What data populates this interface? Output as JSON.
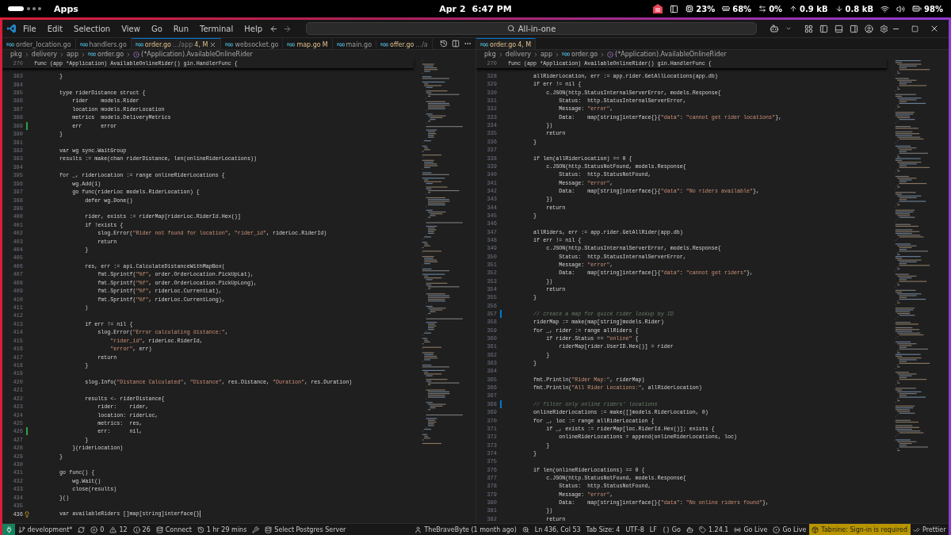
{
  "system_bar": {
    "apps": "Apps",
    "date": "Apr 2",
    "time": "6:47 PM",
    "indicators": [
      {
        "kind": "cpu",
        "text": "23%"
      },
      {
        "kind": "memory",
        "text": "68%"
      },
      {
        "kind": "swap",
        "text": "0%"
      },
      {
        "kind": "upload",
        "text": "0.9 kB"
      },
      {
        "kind": "download",
        "text": "0.8 kB"
      }
    ],
    "battery": "98%"
  },
  "menu": [
    "File",
    "Edit",
    "Selection",
    "View",
    "Go",
    "Run",
    "Terminal",
    "Help"
  ],
  "command_center": {
    "label": "All-in-one"
  },
  "editors": [
    {
      "tabs": [
        {
          "label": "order_location.go",
          "selected": false,
          "modified": false
        },
        {
          "label": "handlers.go",
          "selected": false,
          "modified": false
        },
        {
          "label": "order.go",
          "detail": ".../app",
          "status": "4, M",
          "selected": true,
          "modified": true
        },
        {
          "label": "websocket.go",
          "selected": false,
          "modified": false
        },
        {
          "label": "map.go",
          "status": "M",
          "selected": false,
          "modified": true
        },
        {
          "label": "main.go",
          "selected": false,
          "modified": false
        },
        {
          "label": "offer.go",
          "detail": ".../a",
          "selected": false,
          "modified": true
        }
      ],
      "breadcrumbs": [
        "pkg",
        "delivery",
        "app",
        "order.go",
        "(*Application).AvailableOnlineRider"
      ],
      "sticky": {
        "n": "270",
        "text": "func (app *Application) AvailableOnlineRider() gin.HandlerFunc {"
      },
      "lines": [
        {
          "n": "383",
          "text": "        }"
        },
        {
          "n": "384"
        },
        {
          "n": "385",
          "text": "        type riderDistance struct {"
        },
        {
          "n": "386",
          "text": "            rider    models.Rider"
        },
        {
          "n": "387",
          "text": "            location models.RiderLocation"
        },
        {
          "n": "388",
          "text": "            metrics  models.DeliveryMetrics"
        },
        {
          "n": "389",
          "text": "            err      error",
          "kind": "added"
        },
        {
          "n": "390",
          "text": "        }"
        },
        {
          "n": "391"
        },
        {
          "n": "392",
          "text": "        var wg sync.WaitGroup"
        },
        {
          "n": "393",
          "text": "        results := make(chan riderDistance, len(onlineRiderLocations))"
        },
        {
          "n": "394"
        },
        {
          "n": "395",
          "text": "        for _, riderLocation := range onlineRiderLocations {"
        },
        {
          "n": "396",
          "text": "            wg.Add(1)"
        },
        {
          "n": "397",
          "text": "            go func(riderLoc models.RiderLocation) {"
        },
        {
          "n": "398",
          "text": "                defer wg.Done()"
        },
        {
          "n": "399"
        },
        {
          "n": "400",
          "text": "                rider, exists := riderMap[riderLoc.RiderId.Hex()]"
        },
        {
          "n": "401",
          "text": "                if !exists {"
        },
        {
          "n": "402",
          "text": "                    slog.Error(\"Rider not found for location\", \"rider_id\", riderLoc.RiderId)"
        },
        {
          "n": "403",
          "text": "                    return"
        },
        {
          "n": "404",
          "text": "                }"
        },
        {
          "n": "405"
        },
        {
          "n": "406",
          "text": "                res, err := api.CalculateDistanceWithMapBox("
        },
        {
          "n": "407",
          "text": "                    fmt.Sprintf(\"%f\", order.OrderLocation.PickUpLat),"
        },
        {
          "n": "408",
          "text": "                    fmt.Sprintf(\"%f\", order.OrderLocation.PickUpLong),"
        },
        {
          "n": "409",
          "text": "                    fmt.Sprintf(\"%f\", riderLoc.CurrentLat),"
        },
        {
          "n": "410",
          "text": "                    fmt.Sprintf(\"%f\", riderLoc.CurrentLong),"
        },
        {
          "n": "411",
          "text": "                )"
        },
        {
          "n": "412"
        },
        {
          "n": "413",
          "text": "                if err != nil {"
        },
        {
          "n": "414",
          "text": "                    slog.Error(\"Error calculating distance:\","
        },
        {
          "n": "415",
          "text": "                        \"rider_id\", riderLoc.RiderId,"
        },
        {
          "n": "416",
          "text": "                        \"error\", err)"
        },
        {
          "n": "417",
          "text": "                    return"
        },
        {
          "n": "418",
          "text": "                }"
        },
        {
          "n": "419"
        },
        {
          "n": "420",
          "text": "                slog.Info(\"Distance Calculated\", \"Distance\", res.Distance, \"Duration\", res.Duration)"
        },
        {
          "n": "421"
        },
        {
          "n": "422",
          "text": "                results <- riderDistance{"
        },
        {
          "n": "423",
          "text": "                    rider:    rider,"
        },
        {
          "n": "424",
          "text": "                    location: riderLoc,"
        },
        {
          "n": "425",
          "text": "                    metrics:  res,"
        },
        {
          "n": "426",
          "text": "                    err:      nil,",
          "kind": "added"
        },
        {
          "n": "427",
          "text": "                }"
        },
        {
          "n": "428",
          "text": "            }(riderLocation)"
        },
        {
          "n": "429",
          "text": "        }"
        },
        {
          "n": "430"
        },
        {
          "n": "431",
          "text": "        go func() {"
        },
        {
          "n": "432",
          "text": "            wg.Wait()"
        },
        {
          "n": "433",
          "text": "            close(results)"
        },
        {
          "n": "434",
          "text": "        }()"
        },
        {
          "n": "435"
        },
        {
          "n": "436",
          "text": "        var availableRiders []map[string]interface{}",
          "kind": "hint"
        }
      ]
    },
    {
      "tabs": [
        {
          "label": "order.go",
          "status": "4, M",
          "selected": true,
          "modified": true
        }
      ],
      "breadcrumbs": [
        "pkg",
        "delivery",
        "app",
        "order.go",
        "(*Application).AvailableOnlineRider"
      ],
      "sticky": {
        "n": "270",
        "text": "func (app *Application) AvailableOnlineRider() gin.HandlerFunc {"
      },
      "lines": [
        {
          "n": "328",
          "text": "        allRiderLocation, err := app.rider.GetAllLocations(app.db)"
        },
        {
          "n": "329",
          "text": "        if err != nil {"
        },
        {
          "n": "330",
          "text": "            c.JSON(http.StatusInternalServerError, models.Response{"
        },
        {
          "n": "331",
          "text": "                Status:  http.StatusInternalServerError,"
        },
        {
          "n": "332",
          "text": "                Message: \"error\","
        },
        {
          "n": "333",
          "text": "                Data:    map[string]interface{}{\"data\": \"cannot get rider locations\"},"
        },
        {
          "n": "334",
          "text": "            })"
        },
        {
          "n": "335",
          "text": "            return"
        },
        {
          "n": "336",
          "text": "        }"
        },
        {
          "n": "337"
        },
        {
          "n": "338",
          "text": "        if len(allRiderLocation) == 0 {"
        },
        {
          "n": "339",
          "text": "            c.JSON(http.StatusNotFound, models.Response{"
        },
        {
          "n": "340",
          "text": "                Status:  http.StatusNotFound,"
        },
        {
          "n": "341",
          "text": "                Message: \"error\","
        },
        {
          "n": "342",
          "text": "                Data:    map[string]interface{}{\"data\": \"No riders available\"},"
        },
        {
          "n": "343",
          "text": "            })"
        },
        {
          "n": "344",
          "text": "            return"
        },
        {
          "n": "345",
          "text": "        }"
        },
        {
          "n": "346"
        },
        {
          "n": "347",
          "text": "        allRiders, err := app.rider.GetAllRider(app.db)"
        },
        {
          "n": "348",
          "text": "        if err != nil {"
        },
        {
          "n": "349",
          "text": "            c.JSON(http.StatusInternalServerError, models.Response{"
        },
        {
          "n": "350",
          "text": "                Status:  http.StatusInternalServerError,"
        },
        {
          "n": "351",
          "text": "                Message: \"error\","
        },
        {
          "n": "352",
          "text": "                Data:    map[string]interface{}{\"data\": \"cannot get riders\"},"
        },
        {
          "n": "353",
          "text": "            })"
        },
        {
          "n": "354",
          "text": "            return"
        },
        {
          "n": "355",
          "text": "        }"
        },
        {
          "n": "356"
        },
        {
          "n": "357",
          "text": "        // create a map for quick rider lookup by ID",
          "kind": "modified"
        },
        {
          "n": "358",
          "text": "        riderMap := make(map[string]models.Rider)"
        },
        {
          "n": "359",
          "text": "        for _, rider := range allRiders {"
        },
        {
          "n": "360",
          "text": "            if rider.Status == \"online\" {"
        },
        {
          "n": "361",
          "text": "                riderMap[rider.UserID.Hex()] = rider"
        },
        {
          "n": "362",
          "text": "            }"
        },
        {
          "n": "363",
          "text": "        }"
        },
        {
          "n": "364"
        },
        {
          "n": "365",
          "text": "        fmt.Println(\"Rider Map:\", riderMap)"
        },
        {
          "n": "366",
          "text": "        fmt.Println(\"All Rider Locations:\", allRiderLocation)"
        },
        {
          "n": "367"
        },
        {
          "n": "368",
          "text": "        // filter only online riders' locations",
          "kind": "modified"
        },
        {
          "n": "369",
          "text": "        onlineRiderLocations := make([]models.RiderLocation, 0)"
        },
        {
          "n": "370",
          "text": "        for _, loc := range allRiderLocation {"
        },
        {
          "n": "371",
          "text": "            if _, exists := riderMap[loc.RiderId.Hex()]; exists {"
        },
        {
          "n": "372",
          "text": "                onlineRiderLocations = append(onlineRiderLocations, loc)"
        },
        {
          "n": "373",
          "text": "            }"
        },
        {
          "n": "374",
          "text": "        }"
        },
        {
          "n": "375"
        },
        {
          "n": "376",
          "text": "        if len(onlineRiderLocations) == 0 {"
        },
        {
          "n": "377",
          "text": "            c.JSON(http.StatusNotFound, models.Response{"
        },
        {
          "n": "378",
          "text": "                Status:  http.StatusNotFound,"
        },
        {
          "n": "379",
          "text": "                Message: \"error\","
        },
        {
          "n": "380",
          "text": "                Data:    map[string]interface{}{\"data\": \"No online riders found\"},"
        },
        {
          "n": "381",
          "text": "            })"
        },
        {
          "n": "382",
          "text": "            return"
        }
      ]
    }
  ],
  "status_bar": {
    "left": [
      {
        "kind": "remote"
      },
      {
        "kind": "branch",
        "text": "development*"
      },
      {
        "kind": "sync"
      },
      {
        "kind": "errors",
        "text": "0"
      },
      {
        "kind": "warnings",
        "text": "12"
      },
      {
        "kind": "info",
        "text": "26"
      },
      {
        "kind": "connect",
        "text": "Connect"
      },
      {
        "kind": "timer",
        "text": "1 hr 29 mins"
      },
      {
        "kind": "tool"
      },
      {
        "kind": "database",
        "text": "Select Postgres Server"
      }
    ],
    "right": [
      {
        "kind": "blame",
        "text": "TheBraveByte (1 month ago)"
      },
      {
        "kind": "zoom"
      },
      {
        "kind": "plain",
        "text": "Ln 436, Col 53"
      },
      {
        "kind": "plain",
        "text": "Tab Size: 4"
      },
      {
        "kind": "plain",
        "text": "UTF-8"
      },
      {
        "kind": "plain",
        "text": "LF"
      },
      {
        "kind": "language",
        "text": "Go"
      },
      {
        "kind": "copilot"
      },
      {
        "kind": "version",
        "text": "1.24.1"
      },
      {
        "kind": "broadcast",
        "text": "Go Live"
      },
      {
        "kind": "live",
        "text": "Go Live"
      },
      {
        "kind": "tabnine",
        "text": "Tabnine: Sign-in is required"
      },
      {
        "kind": "prettier",
        "text": "Prettier"
      }
    ]
  }
}
